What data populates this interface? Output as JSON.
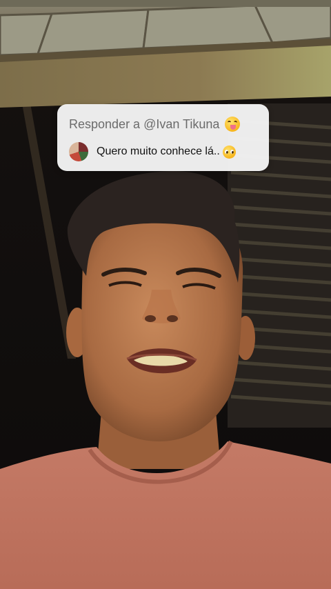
{
  "reply_card": {
    "prefix": "Responder a",
    "username": "@Ivan Tikuna",
    "header_emoji": "drooling-face-icon",
    "comment": "Quero muito conhece lá..",
    "comment_emoji": "pleading-face-icon",
    "avatar": "commenter-avatar"
  },
  "colors": {
    "card_bg": "#f5f5f5",
    "header_text": "#6b6b6b",
    "comment_text": "#111111",
    "shirt": "#c97a68"
  }
}
